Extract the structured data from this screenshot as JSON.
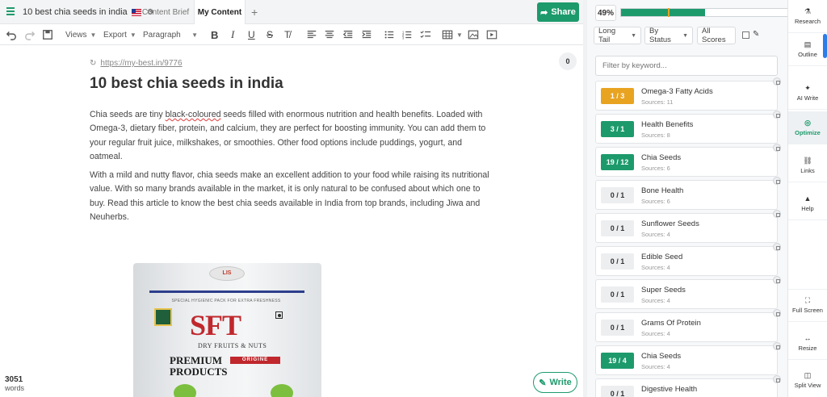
{
  "topbar": {
    "doc_title": "10 best chia seeds in india",
    "tabs": [
      {
        "label": "Content Brief"
      },
      {
        "label": "My Content"
      }
    ],
    "add_tab": "+",
    "share_label": "Share"
  },
  "toolbar": {
    "views": "Views",
    "export": "Export",
    "paragraph": "Paragraph"
  },
  "editor": {
    "url": "https://my-best.in/9776",
    "comment_count": "0",
    "title": "10 best chia seeds in india",
    "p1_a": "Chia seeds are tiny ",
    "p1_misspelled": "black-coloured",
    "p1_b": " seeds filled with enormous nutrition and health benefits. Loaded with Omega-3, dietary fiber, protein, and calcium, they are perfect for boosting immunity. You can add them to your regular fruit juice, milkshakes, or smoothies. Other food options include puddings, yogurt, and oatmeal.",
    "p2": "With a mild and nutty flavor, chia seeds make an excellent addition to your food while raising its nutritional value. With so many brands available in the market, it is only natural to be confused about which one to buy. Read this article to know the best chia seeds available in India from top brands, including Jiwa and Neuherbs.",
    "product": {
      "seal": "LIS",
      "pack_text": "SPECIAL HYGIENIC PACK FOR EXTRA FRESHNESS",
      "brand": "SFT",
      "sub": "DRY FRUITS & NUTS",
      "premium": "PREMIUM",
      "products": "PRODUCTS",
      "origine": "ORIGINE"
    },
    "word_count": "3051",
    "word_label": "words",
    "write_label": "Write"
  },
  "panel": {
    "score_percent": 0.49,
    "score_label": "49%",
    "marker_percent": 0.27,
    "filters": {
      "type": "Long Tail",
      "status": "By Status",
      "scores": "All Scores"
    },
    "keyword_placeholder": "Filter by keyword...",
    "keywords": [
      {
        "badge": "1 / 3",
        "status": "orange",
        "name": "Omega-3 Fatty Acids",
        "sources": "Sources: 11"
      },
      {
        "badge": "3 / 1",
        "status": "green",
        "name": "Health Benefits",
        "sources": "Sources: 8"
      },
      {
        "badge": "19 / 12",
        "status": "green",
        "name": "Chia Seeds",
        "sources": "Sources: 6"
      },
      {
        "badge": "0 / 1",
        "status": "grey",
        "name": "Bone Health",
        "sources": "Sources: 6"
      },
      {
        "badge": "0 / 1",
        "status": "grey",
        "name": "Sunflower Seeds",
        "sources": "Sources: 4"
      },
      {
        "badge": "0 / 1",
        "status": "grey",
        "name": "Edible Seed",
        "sources": "Sources: 4"
      },
      {
        "badge": "0 / 1",
        "status": "grey",
        "name": "Super Seeds",
        "sources": "Sources: 4"
      },
      {
        "badge": "0 / 1",
        "status": "grey",
        "name": "Grams Of Protein",
        "sources": "Sources: 4"
      },
      {
        "badge": "19 / 4",
        "status": "green",
        "name": "Chia Seeds",
        "sources": "Sources: 4"
      },
      {
        "badge": "0 / 1",
        "status": "grey",
        "name": "Digestive Health",
        "sources": ""
      }
    ]
  },
  "rnav": {
    "items": [
      {
        "label": "Research",
        "icon": "research-icon",
        "glyph": "⚗"
      },
      {
        "label": "Outline",
        "icon": "outline-icon",
        "glyph": "▤"
      },
      {
        "label": "AI Write",
        "icon": "magic-wand-icon",
        "glyph": "✦"
      },
      {
        "label": "Optimize",
        "icon": "target-icon",
        "glyph": "◎"
      },
      {
        "label": "Links",
        "icon": "link-icon",
        "glyph": "⛓"
      },
      {
        "label": "Help",
        "icon": "graduation-cap-icon",
        "glyph": "▲"
      },
      {
        "label": "Full Screen",
        "icon": "fullscreen-icon",
        "glyph": "⛶"
      },
      {
        "label": "Resize",
        "icon": "resize-icon",
        "glyph": "↔"
      },
      {
        "label": "Split View",
        "icon": "split-view-icon",
        "glyph": "◫"
      }
    ]
  },
  "colors": {
    "accent": "#1d9a6c",
    "warning": "#e8a321",
    "link_blue": "#2b7de9"
  }
}
